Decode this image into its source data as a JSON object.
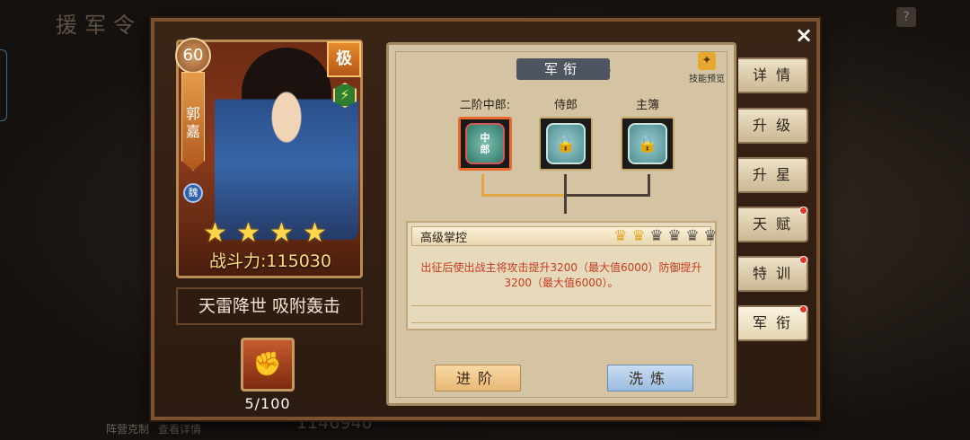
{
  "background": {
    "title": "援军令",
    "help_glyph": "?",
    "bottom_links": [
      "阵营克制",
      "查看详情"
    ],
    "total_power": "1146940"
  },
  "hero": {
    "level": "60",
    "name": "郭嘉",
    "kingdom": "魏",
    "rank_tag": "极",
    "stars": 4,
    "power_label": "战斗力:115030",
    "skills_text": "天雷降世  吸附轰击",
    "item_count": "5/100",
    "item_icon": "fist-icon"
  },
  "rank_panel": {
    "title": "军衔",
    "preview_label": "技能预览",
    "nodes": [
      {
        "label": "二阶中郎:",
        "medal_text": "中\n郎",
        "state": "active"
      },
      {
        "label": "侍郎",
        "state": "locked"
      },
      {
        "label": "主簿",
        "state": "locked"
      }
    ],
    "skill": {
      "name": "高级掌控",
      "stars_filled": 2,
      "stars_total": 6,
      "description": "出征后使出战主将攻击提升3200（最大值6000）防御提升3200（最大值6000）。"
    },
    "advance_button": "进阶",
    "refine_button": "洗炼"
  },
  "side_tabs": [
    {
      "label": "详情",
      "dot": false
    },
    {
      "label": "升级",
      "dot": false
    },
    {
      "label": "升星",
      "dot": false
    },
    {
      "label": "天赋",
      "dot": true
    },
    {
      "label": "特训",
      "dot": true
    },
    {
      "label": "军衔",
      "dot": true
    }
  ],
  "close_label": "×",
  "colors": {
    "accent_gold": "#ffdd82",
    "desc_red": "#c73b1e",
    "active_border": "#e86a2a"
  }
}
